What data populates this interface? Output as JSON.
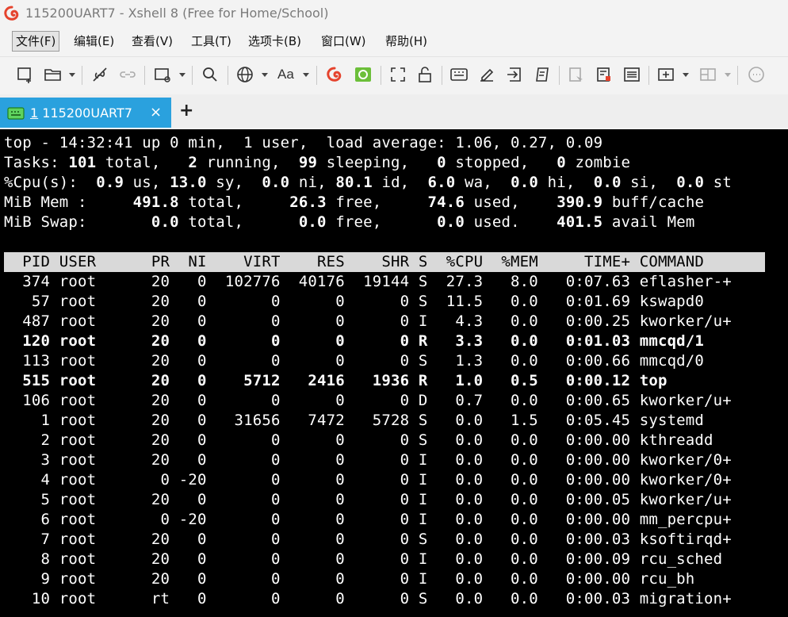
{
  "window": {
    "title": "115200UART7 - Xshell 8 (Free for Home/School)"
  },
  "menu": [
    {
      "label": "文件(F)",
      "selected": true
    },
    {
      "label": "编辑(E)"
    },
    {
      "label": "查看(V)"
    },
    {
      "label": "工具(T)"
    },
    {
      "label": "选项卡(B)"
    },
    {
      "label": "窗口(W)"
    },
    {
      "label": "帮助(H)"
    }
  ],
  "toolbar": {
    "icons": [
      "new-session-icon",
      "open-folder-icon",
      "disconnect-icon",
      "reconnect-icon",
      "new-window-icon",
      "find-icon",
      "globe-icon",
      "font-icon",
      "xshell-icon",
      "xftp-icon",
      "fullscreen-icon",
      "lock-icon",
      "keyboard-icon",
      "compose-icon",
      "transfer-icon",
      "script-icon",
      "send-icon",
      "record-icon",
      "log-icon",
      "add-tab-icon",
      "layout-icon",
      "chat-icon"
    ],
    "font_label": "Aa"
  },
  "tabs": [
    {
      "number": "1",
      "label": "115200UART7",
      "close": "×"
    }
  ],
  "tab_add": "+",
  "terminal": {
    "summary": {
      "uptime": {
        "prefix": "top - ",
        "time": "14:32:41",
        "rest": " up 0 min,  1 user,  load average: 1.06, 0.27, 0.09"
      },
      "tasks": {
        "label": "Tasks: ",
        "total": "101",
        "t1": " total,   ",
        "running": "2",
        "t2": " running,  ",
        "sleeping": "99",
        "t3": " sleeping,   ",
        "stopped": "0",
        "t4": " stopped,   ",
        "zombie": "0",
        "t5": " zombie"
      },
      "cpu": {
        "label": "%Cpu(s):  ",
        "us": "0.9",
        "l1": " us, ",
        "sy": "13.0",
        "l2": " sy,  ",
        "ni": "0.0",
        "l3": " ni, ",
        "id": "80.1",
        "l4": " id,  ",
        "wa": "6.0",
        "l5": " wa,  ",
        "hi": "0.0",
        "l6": " hi,  ",
        "si": "0.0",
        "l7": " si,  ",
        "st": "0.0",
        "l8": " st"
      },
      "mem": {
        "label": "MiB Mem :     ",
        "total": "491.8",
        "l1": " total,     ",
        "free": "26.3",
        "l2": " free,     ",
        "used": "74.6",
        "l3": " used,    ",
        "buff": "390.9",
        "l4": " buff/cache"
      },
      "swap": {
        "label": "MiB Swap:       ",
        "total": "0.0",
        "l1": " total,      ",
        "free": "0.0",
        "l2": " free,      ",
        "used": "0.0",
        "l3": " used.    ",
        "avail": "401.5",
        "l4": " avail Mem"
      }
    },
    "columns": [
      "PID",
      "USER",
      "PR",
      "NI",
      "VIRT",
      "RES",
      "SHR",
      "S",
      "%CPU",
      "%MEM",
      "TIME+",
      "COMMAND"
    ],
    "header_text": "  PID USER      PR  NI    VIRT    RES    SHR S  %CPU  %MEM     TIME+ COMMAND     ",
    "processes": [
      {
        "pid": "374",
        "user": "root",
        "pr": "20",
        "ni": "0",
        "virt": "102776",
        "res": "40176",
        "shr": "19144",
        "s": "S",
        "cpu": "27.3",
        "mem": "8.0",
        "time": "0:07.63",
        "command": "eflasher-+",
        "bold": false
      },
      {
        "pid": "57",
        "user": "root",
        "pr": "20",
        "ni": "0",
        "virt": "0",
        "res": "0",
        "shr": "0",
        "s": "S",
        "cpu": "11.5",
        "mem": "0.0",
        "time": "0:01.69",
        "command": "kswapd0",
        "bold": false
      },
      {
        "pid": "487",
        "user": "root",
        "pr": "20",
        "ni": "0",
        "virt": "0",
        "res": "0",
        "shr": "0",
        "s": "I",
        "cpu": "4.3",
        "mem": "0.0",
        "time": "0:00.25",
        "command": "kworker/u+",
        "bold": false
      },
      {
        "pid": "120",
        "user": "root",
        "pr": "20",
        "ni": "0",
        "virt": "0",
        "res": "0",
        "shr": "0",
        "s": "R",
        "cpu": "3.3",
        "mem": "0.0",
        "time": "0:01.03",
        "command": "mmcqd/1",
        "bold": true
      },
      {
        "pid": "113",
        "user": "root",
        "pr": "20",
        "ni": "0",
        "virt": "0",
        "res": "0",
        "shr": "0",
        "s": "S",
        "cpu": "1.3",
        "mem": "0.0",
        "time": "0:00.66",
        "command": "mmcqd/0",
        "bold": false
      },
      {
        "pid": "515",
        "user": "root",
        "pr": "20",
        "ni": "0",
        "virt": "5712",
        "res": "2416",
        "shr": "1936",
        "s": "R",
        "cpu": "1.0",
        "mem": "0.5",
        "time": "0:00.12",
        "command": "top",
        "bold": true
      },
      {
        "pid": "106",
        "user": "root",
        "pr": "20",
        "ni": "0",
        "virt": "0",
        "res": "0",
        "shr": "0",
        "s": "D",
        "cpu": "0.7",
        "mem": "0.0",
        "time": "0:00.65",
        "command": "kworker/u+",
        "bold": false
      },
      {
        "pid": "1",
        "user": "root",
        "pr": "20",
        "ni": "0",
        "virt": "31656",
        "res": "7472",
        "shr": "5728",
        "s": "S",
        "cpu": "0.0",
        "mem": "1.5",
        "time": "0:05.45",
        "command": "systemd",
        "bold": false
      },
      {
        "pid": "2",
        "user": "root",
        "pr": "20",
        "ni": "0",
        "virt": "0",
        "res": "0",
        "shr": "0",
        "s": "S",
        "cpu": "0.0",
        "mem": "0.0",
        "time": "0:00.00",
        "command": "kthreadd",
        "bold": false
      },
      {
        "pid": "3",
        "user": "root",
        "pr": "20",
        "ni": "0",
        "virt": "0",
        "res": "0",
        "shr": "0",
        "s": "I",
        "cpu": "0.0",
        "mem": "0.0",
        "time": "0:00.00",
        "command": "kworker/0+",
        "bold": false
      },
      {
        "pid": "4",
        "user": "root",
        "pr": "0",
        "ni": "-20",
        "virt": "0",
        "res": "0",
        "shr": "0",
        "s": "I",
        "cpu": "0.0",
        "mem": "0.0",
        "time": "0:00.00",
        "command": "kworker/0+",
        "bold": false
      },
      {
        "pid": "5",
        "user": "root",
        "pr": "20",
        "ni": "0",
        "virt": "0",
        "res": "0",
        "shr": "0",
        "s": "I",
        "cpu": "0.0",
        "mem": "0.0",
        "time": "0:00.05",
        "command": "kworker/u+",
        "bold": false
      },
      {
        "pid": "6",
        "user": "root",
        "pr": "0",
        "ni": "-20",
        "virt": "0",
        "res": "0",
        "shr": "0",
        "s": "I",
        "cpu": "0.0",
        "mem": "0.0",
        "time": "0:00.00",
        "command": "mm_percpu+",
        "bold": false
      },
      {
        "pid": "7",
        "user": "root",
        "pr": "20",
        "ni": "0",
        "virt": "0",
        "res": "0",
        "shr": "0",
        "s": "S",
        "cpu": "0.0",
        "mem": "0.0",
        "time": "0:00.03",
        "command": "ksoftirqd+",
        "bold": false
      },
      {
        "pid": "8",
        "user": "root",
        "pr": "20",
        "ni": "0",
        "virt": "0",
        "res": "0",
        "shr": "0",
        "s": "I",
        "cpu": "0.0",
        "mem": "0.0",
        "time": "0:00.09",
        "command": "rcu_sched",
        "bold": false
      },
      {
        "pid": "9",
        "user": "root",
        "pr": "20",
        "ni": "0",
        "virt": "0",
        "res": "0",
        "shr": "0",
        "s": "I",
        "cpu": "0.0",
        "mem": "0.0",
        "time": "0:00.00",
        "command": "rcu_bh",
        "bold": false
      },
      {
        "pid": "10",
        "user": "root",
        "pr": "rt",
        "ni": "0",
        "virt": "0",
        "res": "0",
        "shr": "0",
        "s": "S",
        "cpu": "0.0",
        "mem": "0.0",
        "time": "0:00.03",
        "command": "migration+",
        "bold": false
      }
    ]
  },
  "colors": {
    "tab_active": "#2aa1de",
    "terminal_bg": "#000000",
    "terminal_fg": "#ffffff",
    "header_bg": "#d9d9d9"
  }
}
